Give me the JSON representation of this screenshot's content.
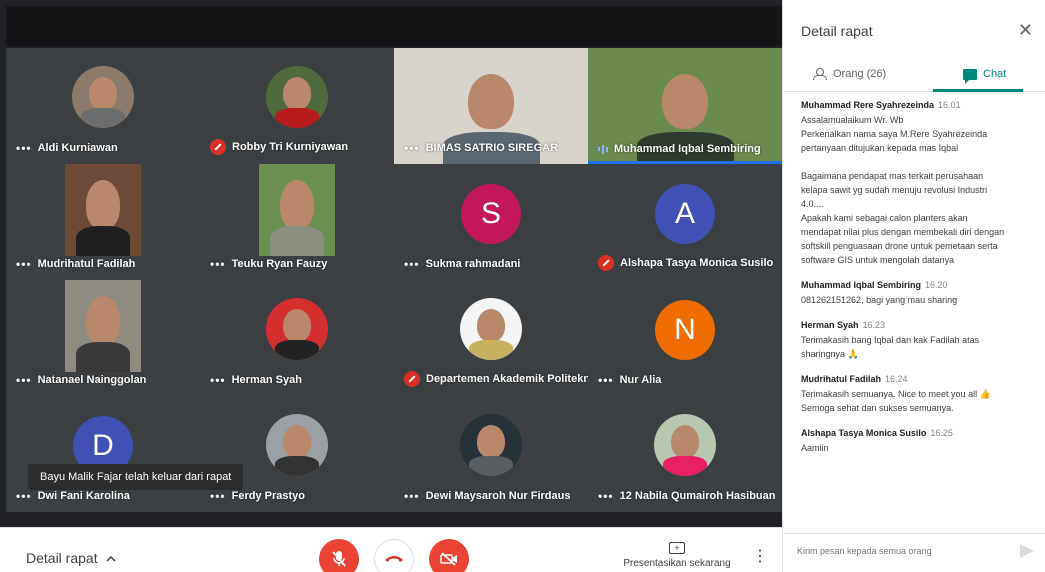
{
  "colors": {
    "accent": "#00897b",
    "danger": "#ea4335",
    "stage_bg": "#202124",
    "tile_bg": "#3c4043"
  },
  "toast": "Bayu Malik Fajar telah keluar dari rapat",
  "tiles": [
    {
      "name": "Aldi Kurniawan",
      "status": "more"
    },
    {
      "name": "Robby Tri Kurniyawan",
      "status": "muted"
    },
    {
      "name": "BIMAS SATRIO SIREGAR",
      "status": "more"
    },
    {
      "name": "Muhammad Iqbal Sembiring",
      "status": "speaking"
    },
    {
      "name": "Mudrihatul Fadilah",
      "status": "more"
    },
    {
      "name": "Teuku Ryan Fauzy",
      "status": "more"
    },
    {
      "name": "Sukma rahmadani",
      "status": "more",
      "letter": "S",
      "letter_color": "#c2185b"
    },
    {
      "name": "Alshapa Tasya Monica Susilo",
      "status": "muted",
      "letter": "A",
      "letter_color": "#3f51b5"
    },
    {
      "name": "Natanael Nainggolan",
      "status": "more"
    },
    {
      "name": "Herman Syah",
      "status": "more"
    },
    {
      "name": "Departemen Akademik Politekni...",
      "status": "muted"
    },
    {
      "name": "Nur Alia",
      "status": "more",
      "letter": "N",
      "letter_color": "#ef6c00"
    },
    {
      "name": "Dwi Fani Karolina",
      "status": "more",
      "letter": "D",
      "letter_color": "#3f51b5"
    },
    {
      "name": "Ferdy Prastyo",
      "status": "more"
    },
    {
      "name": "Dewi Maysaroh Nur Firdaus",
      "status": "more"
    },
    {
      "name": "12 Nabila Qumairoh Hasibuan",
      "status": "more"
    }
  ],
  "bottombar": {
    "details_label": "Detail rapat",
    "present_label": "Presentasikan sekarang",
    "more_icon": "more-vert-icon"
  },
  "panel": {
    "title": "Detail rapat",
    "tabs": {
      "people": "Orang (26)",
      "chat": "Chat"
    },
    "compose_placeholder": "Kirim pesan kepada semua orang",
    "messages": [
      {
        "sender": "Muhammad Rere Syahrezeinda",
        "time": "16.01",
        "lines": [
          "Assalamualaikum Wr. Wb",
          "Perkenalkan nama saya M.Rere Syahrezeinda",
          "pertanyaan ditujukan kepada mas Iqbal",
          "",
          "Bagaimana pendapat mas terkait perusahaan",
          "kelapa sawit yg sudah menuju revolusi Industri",
          "4.0....",
          "Apakah kami sebagai calon planters akan",
          "mendapat nilai plus dengan membekali diri dengan",
          "softskill penguasaan drone untuk pemetaan serta",
          "software GIS untuk mengolah datanya"
        ]
      },
      {
        "sender": "Muhammad Iqbal Sembiring",
        "time": "16.20",
        "lines": [
          "081262151262, bagi yang mau sharing"
        ]
      },
      {
        "sender": "Herman Syah",
        "time": "16.23",
        "lines": [
          "Terimakasih bang Iqbal dan kak Fadilah atas",
          "sharingnya 🙏"
        ]
      },
      {
        "sender": "Mudrihatul Fadilah",
        "time": "16.24",
        "lines": [
          "Terimakasih semuanya. Nice to meet you all 👍",
          "Semoga sehat dan sukses semuanya."
        ]
      },
      {
        "sender": "Alshapa Tasya Monica Susilo",
        "time": "16.25",
        "lines": [
          "Aamiin"
        ]
      }
    ]
  }
}
